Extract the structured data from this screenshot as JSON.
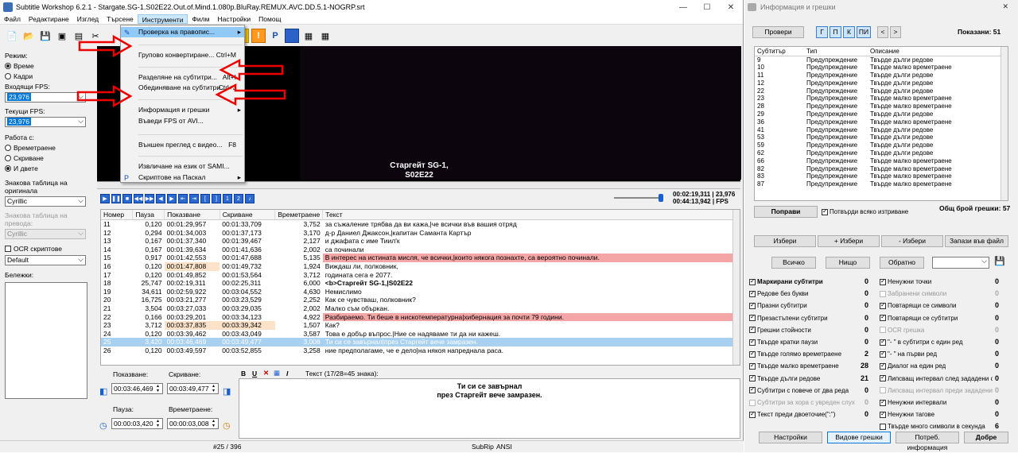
{
  "window": {
    "title": "Subtitle Workshop 6.2.1 - Stargate.SG-1.S02E22.Out.of.Mind.1.080p.BluRay.REMUX.AVC.DD.5.1-NOGRP.srt",
    "minimize": "—",
    "maximize": "☐",
    "close": "✕"
  },
  "menubar": [
    "Файл",
    "Редактиране",
    "Изглед",
    "Търсене",
    "Инструменти",
    "Филм",
    "Настройки",
    "Помощ"
  ],
  "left": {
    "mode_label": "Режим:",
    "mode_time": "Време",
    "mode_frames": "Кадри",
    "in_fps_label": "Входящи FPS:",
    "in_fps": "23,976",
    "cur_fps_label": "Текущи FPS:",
    "cur_fps": "23,976",
    "work_label": "Работа с:",
    "work_duration": "Времетраене",
    "work_hide": "Скриване",
    "work_both": "И двете",
    "orig_table_label": "Знакова таблица на оригинала",
    "orig_table": "Cyrillic",
    "trans_table_label": "Знакова таблица на превода:",
    "trans_table": "Cyrillic",
    "ocr_label": "OCR скриптове",
    "ocr_value": "Default",
    "notes_label": "Бележки:"
  },
  "video": {
    "subtitle_line1": "Старгейт SG-1,",
    "subtitle_line2": "S02E22",
    "time_cur": "00:02:19,311",
    "time_total": "00:44:13,942",
    "fps": "23,976",
    "fps_unit": "FPS"
  },
  "tools_menu": {
    "items": [
      {
        "label": "Проверка на правопис...",
        "shortcut": "",
        "sub": true
      },
      {
        "label": "Групово конвертиране...",
        "shortcut": "Ctrl+M",
        "sub": false
      },
      {
        "label": "Разделяне на субтитри...",
        "shortcut": "Alt+I",
        "sub": false
      },
      {
        "label": "Обединяване на субтитри...",
        "shortcut": "Ctrl+J",
        "sub": false
      },
      {
        "label": "Информация и грешки",
        "shortcut": "",
        "sub": true
      },
      {
        "label": "Въведи FPS от AVI...",
        "shortcut": "",
        "sub": false
      },
      {
        "label": "Външен преглед с видео...",
        "shortcut": "F8",
        "sub": false
      },
      {
        "label": "Извличане на език от SAMI...",
        "shortcut": "",
        "sub": false
      },
      {
        "label": "Скриптове на Паскал",
        "shortcut": "",
        "sub": true
      }
    ]
  },
  "grid": {
    "headers": [
      "Номер",
      "Пауза",
      "Показване",
      "Скриване",
      "Времетраене",
      "Текст"
    ],
    "rows": [
      [
        "11",
        "0,120",
        "00:01:29,957",
        "00:01:33,709",
        "3,752",
        "за съжаление трябва да ви кажа,|че всички във вашия отряд"
      ],
      [
        "12",
        "0,294",
        "00:01:34,003",
        "00:01:37,173",
        "3,170",
        "д-р Даниел Джаксон,|капитан Саманта Картър"
      ],
      [
        "13",
        "0,167",
        "00:01:37,340",
        "00:01:39,467",
        "2,127",
        "и джафата с име Тиил'к"
      ],
      [
        "14",
        "0,167",
        "00:01:39,634",
        "00:01:41,636",
        "2,002",
        "са починали"
      ],
      [
        "15",
        "0,917",
        "00:01:42,553",
        "00:01:47,688",
        "5,135",
        "В интерес на истината мисля, че всички,|които някога познахте, са вероятно починали."
      ],
      [
        "16",
        "0,120",
        "00:01:47,808",
        "00:01:49,732",
        "1,924",
        "Виждаш ли, полковник,"
      ],
      [
        "17",
        "0,120",
        "00:01:49,852",
        "00:01:53,564",
        "3,712",
        "годината сега е 2077."
      ],
      [
        "18",
        "25,747",
        "00:02:19,311",
        "00:02:25,311",
        "6,000",
        "<b>Старгейт SG-1,|S02E22"
      ],
      [
        "19",
        "34,611",
        "00:02:59,922",
        "00:03:04,552",
        "4,630",
        "Немислимо"
      ],
      [
        "20",
        "16,725",
        "00:03:21,277",
        "00:03:23,529",
        "2,252",
        "Как се чувстваш, полковник?"
      ],
      [
        "21",
        "3,504",
        "00:03:27,033",
        "00:03:29,035",
        "2,002",
        "Малко съм объркан."
      ],
      [
        "22",
        "0,166",
        "00:03:29,201",
        "00:03:34,123",
        "4,922",
        "Разбираемо. Ти беше в нискотемпературна|хибернация за почти 79 години."
      ],
      [
        "23",
        "3,712",
        "00:03:37,835",
        "00:03:39,342",
        "1,507",
        "Как?"
      ],
      [
        "24",
        "0,120",
        "00:03:39,462",
        "00:03:43,049",
        "3,587",
        "Това е добър въпрос.|Ние се надяваме ти да ни кажеш."
      ],
      [
        "25",
        "3,420",
        "00:03:46,469",
        "00:03:49,477",
        "3,008",
        "Ти си се завърнал|през Старгейт вече замразен."
      ],
      [
        "26",
        "0,120",
        "00:03:49,597",
        "00:03:52,855",
        "3,258",
        "ние предполагаме, че е дело|на някоя напреднала раса."
      ]
    ]
  },
  "edit": {
    "show_label": "Показване:",
    "show_value": "00:03:46,469",
    "hide_label": "Скриване:",
    "hide_value": "00:03:49,477",
    "pause_label": "Пауза:",
    "pause_value": "00:00:03,420",
    "dur_label": "Времетраене:",
    "dur_value": "00:00:03,008",
    "text_label": "Текст (17/28=45 знака):",
    "text_line1": "Ти си се завърнал",
    "text_line2": "през Старгейт вече замразен.",
    "fmt_bold": "B",
    "fmt_italic": "I",
    "fmt_underline": "U",
    "fmt_clear": "✕",
    "fmt_ital2": "I"
  },
  "status": {
    "position": "#25 / 396",
    "format": "SubRip",
    "encoding": "ANSI"
  },
  "panel": {
    "title": "Информация и грешки",
    "close": "✕",
    "check_btn": "Провери",
    "filter_btns": [
      "Г",
      "П",
      "К",
      "ПИ"
    ],
    "prev": "<",
    "next": ">",
    "shown": "Показани: 51",
    "list_headers": [
      "Субтитър",
      "Тип",
      "Описание"
    ],
    "list": [
      [
        "9",
        "Предупреждение",
        "Твърде дълги редове"
      ],
      [
        "10",
        "Предупреждение",
        "Твърде малко времетраене"
      ],
      [
        "11",
        "Предупреждение",
        "Твърде дълги редове"
      ],
      [
        "12",
        "Предупреждение",
        "Твърде дълги редове"
      ],
      [
        "22",
        "Предупреждение",
        "Твърде дълги редове"
      ],
      [
        "23",
        "Предупреждение",
        "Твърде малко времетраене"
      ],
      [
        "28",
        "Предупреждение",
        "Твърде малко времетраене"
      ],
      [
        "29",
        "Предупреждение",
        "Твърде дълги редове"
      ],
      [
        "36",
        "Предупреждение",
        "Твърде малко времетраене"
      ],
      [
        "41",
        "Предупреждение",
        "Твърде дълги редове"
      ],
      [
        "53",
        "Предупреждение",
        "Твърде дълги редове"
      ],
      [
        "59",
        "Предупреждение",
        "Твърде дълги редове"
      ],
      [
        "62",
        "Предупреждение",
        "Твърде дълги редове"
      ],
      [
        "66",
        "Предупреждение",
        "Твърде малко времетраене"
      ],
      [
        "82",
        "Предупреждение",
        "Твърде малко времетраене"
      ],
      [
        "83",
        "Предупреждение",
        "Твърде малко времетраене"
      ],
      [
        "87",
        "Предупреждение",
        "Твърде малко времетраене"
      ]
    ],
    "fix_btn": "Поправи",
    "confirm_delete": "Потвърди всяко изтриване",
    "total_errors": "Общ брой грешки: 57",
    "select_btn": "Избери",
    "add_select_btn": "+ Избери",
    "minus_select_btn": "- Избери",
    "save_file_btn": "Запази във файл",
    "all_btn": "Всичко",
    "none_btn": "Нищо",
    "invert_btn": "Обратно",
    "checks_left": [
      {
        "label": "Маркирани субтитри",
        "count": "0",
        "on": true,
        "dis": false,
        "bold": true
      },
      {
        "label": "Редове без букви",
        "count": "0",
        "on": true,
        "dis": false,
        "bold": false
      },
      {
        "label": "Празни субтитри",
        "count": "0",
        "on": true,
        "dis": false,
        "bold": false
      },
      {
        "label": "Презастъпени субтитри",
        "count": "0",
        "on": true,
        "dis": false,
        "bold": false
      },
      {
        "label": "Грешни стойности",
        "count": "0",
        "on": true,
        "dis": false,
        "bold": false
      },
      {
        "label": "Твърде кратки паузи",
        "count": "0",
        "on": true,
        "dis": false,
        "bold": false
      },
      {
        "label": "Твърде голямо времетраене",
        "count": "2",
        "on": true,
        "dis": false,
        "bold": false
      },
      {
        "label": "Твърде малко времетраене",
        "count": "28",
        "on": true,
        "dis": false,
        "bold": false
      },
      {
        "label": "Твърде дълги редове",
        "count": "21",
        "on": true,
        "dis": false,
        "bold": false
      },
      {
        "label": "Субтитри с повече от два реда",
        "count": "0",
        "on": true,
        "dis": false,
        "bold": false
      },
      {
        "label": "Субтитри за хора с увреден слух",
        "count": "0",
        "on": false,
        "dis": true,
        "bold": false
      },
      {
        "label": "Текст преди двоеточие(\":\")",
        "count": "0",
        "on": true,
        "dis": false,
        "bold": false
      }
    ],
    "checks_right": [
      {
        "label": "Ненужни точки",
        "count": "0",
        "on": true,
        "dis": false
      },
      {
        "label": "Забранени символи",
        "count": "0",
        "on": false,
        "dis": true
      },
      {
        "label": "Повтарящи се символи",
        "count": "0",
        "on": true,
        "dis": false
      },
      {
        "label": "Повтарящи се субтитри",
        "count": "0",
        "on": true,
        "dis": false
      },
      {
        "label": "OCR грешка",
        "count": "0",
        "on": false,
        "dis": true
      },
      {
        "label": "\"- \" в субтитри с един ред",
        "count": "0",
        "on": true,
        "dis": false
      },
      {
        "label": "\"- \" на първи ред",
        "count": "0",
        "on": true,
        "dis": false
      },
      {
        "label": "Диалог на един ред",
        "count": "0",
        "on": true,
        "dis": false
      },
      {
        "label": "Липсващ интервал след зададени символи",
        "count": "0",
        "on": true,
        "dis": false
      },
      {
        "label": "Липсващ интервал преди зададени символи",
        "count": "0",
        "on": false,
        "dis": true
      },
      {
        "label": "Ненужни интервали",
        "count": "0",
        "on": true,
        "dis": false
      },
      {
        "label": "Ненужни тагове",
        "count": "0",
        "on": true,
        "dis": false
      },
      {
        "label": "Твърде много символи в секунда",
        "count": "6",
        "on": false,
        "dis": false
      }
    ],
    "settings_btn": "Настройки",
    "types_btn": "Видове грешки",
    "user_info_btn": "Потреб. информация",
    "ok_btn": "Добре"
  }
}
